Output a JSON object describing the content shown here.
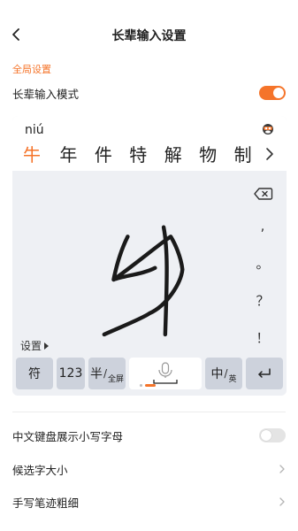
{
  "header": {
    "title": "长辈输入设置"
  },
  "section": {
    "label": "全局设置"
  },
  "elder_mode": {
    "label": "长辈输入模式",
    "enabled": true
  },
  "keyboard": {
    "pinyin": "niú",
    "candidates": [
      "牛",
      "年",
      "件",
      "特",
      "解",
      "物",
      "制"
    ],
    "settings_label": "设置",
    "side_keys": [
      ",",
      "。",
      "？",
      "！"
    ],
    "keys": {
      "symbol": "符",
      "number": "123",
      "half_main": "半",
      "half_sub": "全屏",
      "lang_main": "中",
      "lang_sub": "英"
    }
  },
  "settings": [
    {
      "label": "中文键盘展示小写字母",
      "type": "toggle",
      "enabled": false
    },
    {
      "label": "候选字大小",
      "type": "link"
    },
    {
      "label": "手写笔迹粗细",
      "type": "link"
    }
  ],
  "colors": {
    "accent": "#f5742a",
    "key": "#cdd2dc",
    "keyboard_bg": "#eef0f4"
  }
}
